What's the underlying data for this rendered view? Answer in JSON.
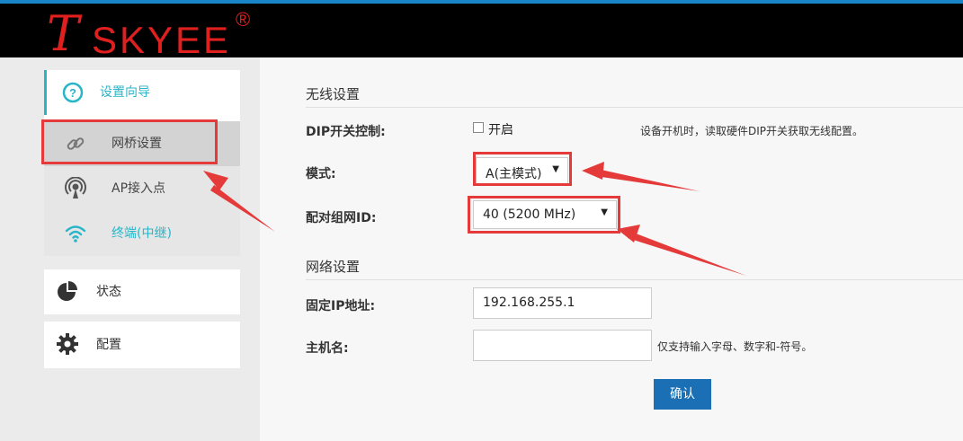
{
  "brand": {
    "logo_text": "TSKYEE",
    "registered_mark": "®"
  },
  "sidebar": {
    "items": [
      {
        "label": "设置向导",
        "icon": "question-circle-icon"
      },
      {
        "label": "网桥设置",
        "icon": "link-icon"
      },
      {
        "label": "AP接入点",
        "icon": "broadcast-icon"
      },
      {
        "label": "终端(中继)",
        "icon": "wifi-icon"
      },
      {
        "label": "状态",
        "icon": "pie-chart-icon"
      },
      {
        "label": "配置",
        "icon": "gear-icon"
      }
    ]
  },
  "wireless": {
    "section_title": "无线设置",
    "dip_label": "DIP开关控制:",
    "dip_checkbox_label": "开启",
    "dip_checked": false,
    "dip_hint": "设备开机时，读取硬件DIP开关获取无线配置。",
    "mode_label": "模式:",
    "mode_value": "A(主模式)",
    "pair_label": "配对组网ID:",
    "pair_value": "40 (5200 MHz)"
  },
  "network": {
    "section_title": "网络设置",
    "ip_label": "固定IP地址:",
    "ip_value": "192.168.255.1",
    "host_label": "主机名:",
    "host_value": "",
    "host_hint": "仅支持输入字母、数字和-符号。",
    "confirm_label": "确认"
  },
  "colors": {
    "accent": "#1a6fb5",
    "brand_red": "#e0201e",
    "highlight": "#e53a3a",
    "teal": "#28b5c8"
  }
}
